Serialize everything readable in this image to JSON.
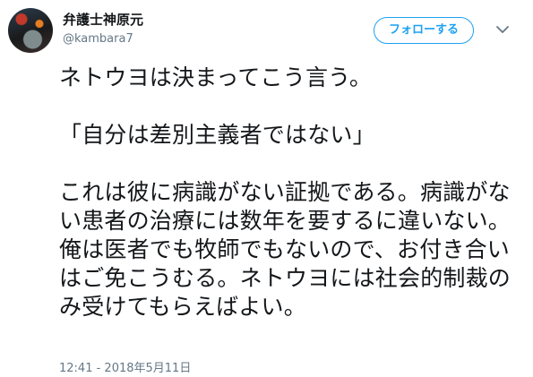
{
  "profile": {
    "display_name": "弁護士神原元",
    "handle": "@kambara7"
  },
  "follow": {
    "label": "フォローする"
  },
  "menu": {
    "icon": "chevron-down-icon"
  },
  "tweet": {
    "text": "ネトウヨは決まってこう言う。\n\n「自分は差別主義者ではない」\n\nこれは彼に病識がない証拠である。病識がない患者の治療には数年を要するに違いない。俺は医者でも牧師でもないので、お付き合いはご免こうむる。ネトウヨには社会的制裁のみ受けてもらえばよい。",
    "timestamp": "12:41 - 2018年5月11日"
  },
  "colors": {
    "accent": "#1da1f2",
    "text": "#14171a",
    "secondary": "#657786"
  }
}
